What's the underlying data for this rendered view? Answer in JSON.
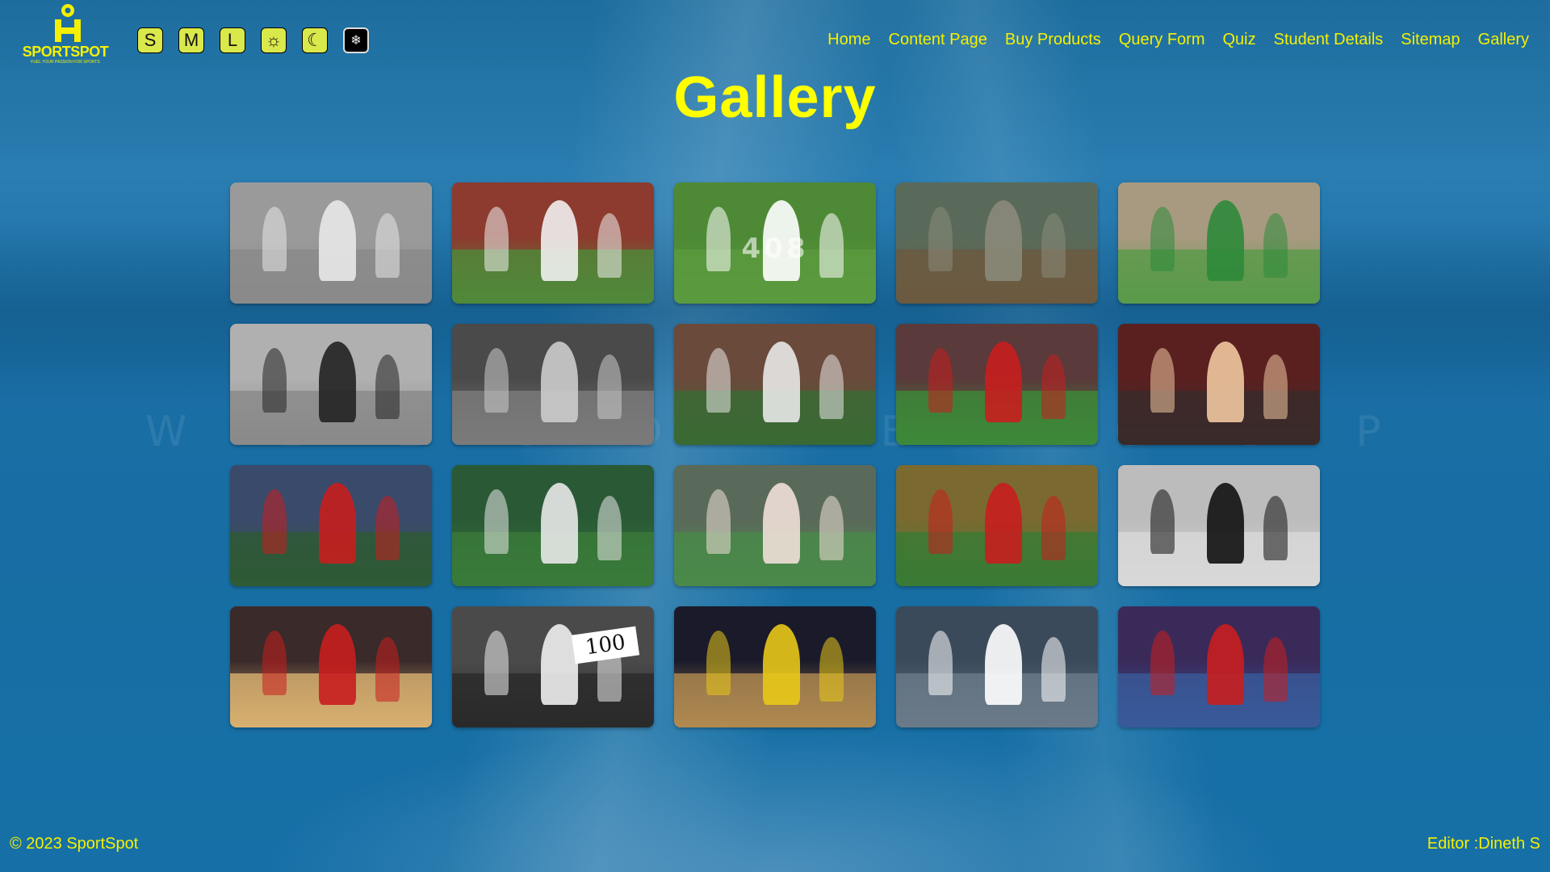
{
  "brand": {
    "name": "SPORTSPOT",
    "tagline": "FUEL YOUR PASSION FOR SPORTS",
    "color": "#f5f000",
    "logo_icon": "sportspot-logo-icon"
  },
  "controls": [
    {
      "label": "S",
      "name": "font-size-small-button"
    },
    {
      "label": "M",
      "name": "font-size-medium-button"
    },
    {
      "label": "L",
      "name": "font-size-large-button"
    },
    {
      "label": "☼",
      "name": "light-theme-button",
      "icon": "sun-icon"
    },
    {
      "label": "☾",
      "name": "dark-theme-button",
      "icon": "moon-icon"
    },
    {
      "label": "❄",
      "name": "blue-theme-button",
      "icon": "snowflake-icon"
    }
  ],
  "nav": [
    {
      "label": "Home",
      "name": "nav-home"
    },
    {
      "label": "Content Page",
      "name": "nav-content-page"
    },
    {
      "label": "Buy Products",
      "name": "nav-buy-products"
    },
    {
      "label": "Query Form",
      "name": "nav-query-form"
    },
    {
      "label": "Quiz",
      "name": "nav-quiz"
    },
    {
      "label": "Student Details",
      "name": "nav-student-details"
    },
    {
      "label": "Sitemap",
      "name": "nav-sitemap"
    },
    {
      "label": "Gallery",
      "name": "nav-gallery"
    }
  ],
  "page_title": "Gallery",
  "gallery": [
    {
      "name": "cricket-photo-1",
      "bg": "#9a9a9a",
      "field": "#8a8a8a",
      "fig": "#e8e8e8"
    },
    {
      "name": "cricket-photo-2",
      "bg": "#8c3b2e",
      "field": "#4f8a3a",
      "fig": "#f0f0f0"
    },
    {
      "name": "cricket-photo-3",
      "bg": "#4e8a35",
      "field": "#5b9a3f",
      "fig": "#ffffff",
      "caption": "408"
    },
    {
      "name": "cricket-photo-4",
      "bg": "#5a6a5a",
      "field": "#6b5a40",
      "fig": "#8a8a7a"
    },
    {
      "name": "cricket-photo-5",
      "bg": "#a89a80",
      "field": "#5a9a4a",
      "fig": "#2d8a3a"
    },
    {
      "name": "football-photo-1",
      "bg": "#b0b0b0",
      "field": "#8a8a8a",
      "fig": "#222222"
    },
    {
      "name": "football-photo-2",
      "bg": "#4a4a4a",
      "field": "#7a7a7a",
      "fig": "#cccccc"
    },
    {
      "name": "football-photo-3",
      "bg": "#6a4a3a",
      "field": "#3a6a35",
      "fig": "#e8e8e8"
    },
    {
      "name": "football-photo-4",
      "bg": "#5a3a3a",
      "field": "#3c8a3a",
      "fig": "#c81e1e"
    },
    {
      "name": "football-photo-5",
      "bg": "#5a2020",
      "field": "#3a2a2a",
      "fig": "#f0c8a0"
    },
    {
      "name": "rugby-photo-1",
      "bg": "#3a4a6a",
      "field": "#2e5a35",
      "fig": "#c81e1e"
    },
    {
      "name": "rugby-photo-2",
      "bg": "#2a5a35",
      "field": "#3a7a3a",
      "fig": "#e8e8e8"
    },
    {
      "name": "rugby-photo-3",
      "bg": "#5a6a5a",
      "field": "#4a8a4a",
      "fig": "#f0e0d8"
    },
    {
      "name": "rugby-photo-4",
      "bg": "#7a6a30",
      "field": "#3a7a35",
      "fig": "#c81e1e"
    },
    {
      "name": "rugby-photo-5",
      "bg": "#bcbcbc",
      "field": "#d8d8d8",
      "fig": "#111111"
    },
    {
      "name": "basketball-photo-1",
      "bg": "#3a2a2a",
      "field": "#d8b070",
      "fig": "#c81e1e"
    },
    {
      "name": "basketball-photo-2",
      "bg": "#4a4a4a",
      "field": "#2a2a2a",
      "fig": "#eeeeee",
      "card": "100"
    },
    {
      "name": "basketball-photo-3",
      "bg": "#1a1a2a",
      "field": "#b08a50",
      "fig": "#e8c818"
    },
    {
      "name": "basketball-photo-4",
      "bg": "#3a4a5a",
      "field": "#6a7a8a",
      "fig": "#ffffff"
    },
    {
      "name": "basketball-photo-5",
      "bg": "#3a2a5a",
      "field": "#3a5a9a",
      "fig": "#c81e1e"
    }
  ],
  "watermark": "W E L C O M E T O S P O R T S P O T A C T I O N",
  "footer": {
    "copyright": "© 2023 SportSpot",
    "editor": "Editor :Dineth S"
  }
}
